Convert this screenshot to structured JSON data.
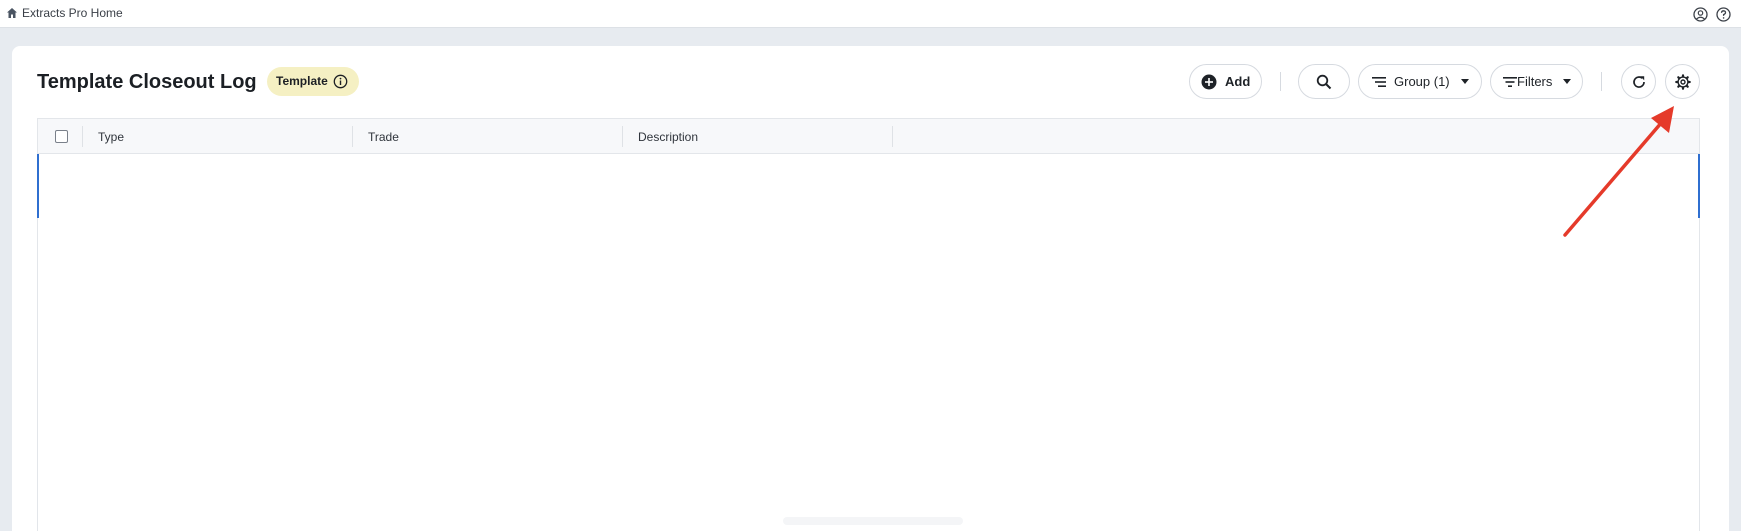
{
  "topbar": {
    "home_icon": "home-icon",
    "breadcrumb": "Extracts Pro Home",
    "user_icon": "user-circle-icon",
    "help_icon": "help-circle-icon"
  },
  "page": {
    "title": "Template Closeout Log",
    "badge_label": "Template",
    "badge_icon": "info-icon",
    "badge_color": "#f5f0c3"
  },
  "toolbar": {
    "add_label": "Add",
    "add_icon": "plus-circle-icon",
    "search_icon": "search-icon",
    "group_label": "Group (1)",
    "group_icon": "group-lines-icon",
    "filters_label": "Filters",
    "filters_icon": "filter-icon",
    "refresh_icon": "refresh-icon",
    "settings_icon": "gear-icon"
  },
  "grid": {
    "columns": [
      "Type",
      "Trade",
      "Description"
    ],
    "rows": [],
    "selected_row_color": "#2f6fd0"
  },
  "annotation": {
    "arrow_color": "#e53a2a",
    "points_to": "gear-icon"
  }
}
